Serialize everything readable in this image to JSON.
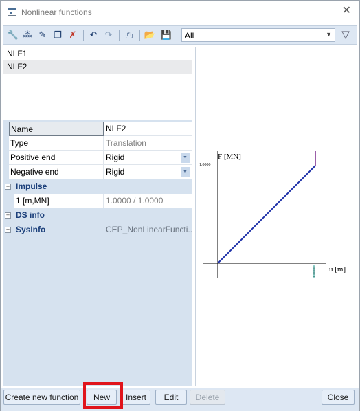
{
  "window": {
    "title": "Nonlinear functions"
  },
  "toolbar": {
    "icons": [
      "function-icon",
      "network-icon",
      "pencil-icon",
      "copy-icon",
      "delete-icon",
      "undo-icon",
      "redo-icon",
      "print-icon",
      "open-folder-icon",
      "save-icon"
    ],
    "filter_value": "All"
  },
  "functions": [
    "NLF1",
    "NLF2"
  ],
  "selected_function": "NLF2",
  "properties": {
    "name": {
      "label": "Name",
      "value": "NLF2"
    },
    "type": {
      "label": "Type",
      "value": "Translation"
    },
    "positive_end": {
      "label": "Positive end",
      "value": "Rigid"
    },
    "negative_end": {
      "label": "Negative end",
      "value": "Rigid"
    },
    "impulse": {
      "label": "Impulse",
      "row_label": "1 [m,MN]",
      "row_value": "1.0000 / 1.0000",
      "expander": "−"
    },
    "ds_info": {
      "label": "DS info",
      "expander": "+"
    },
    "sysinfo": {
      "label": "SysInfo",
      "value": "CEP_NonLinearFuncti...",
      "expander": "+"
    }
  },
  "graph": {
    "y_axis_label": "F [MN]",
    "x_axis_label": "u [m]",
    "y_tick": "1.0000",
    "x_tick": "1.0000",
    "line_color": "#1c2fa8",
    "end_color": "#7b2a8c",
    "tick_color": "#2aa59a"
  },
  "chart_data": {
    "type": "line",
    "title": "",
    "xlabel": "u [m]",
    "ylabel": "F [MN]",
    "series": [
      {
        "x": [
          0,
          1.0
        ],
        "y": [
          0,
          1.0
        ]
      }
    ]
  },
  "buttons": {
    "create_new_function": "Create new function",
    "new": "New",
    "insert": "Insert",
    "edit": "Edit",
    "delete": "Delete",
    "close": "Close"
  }
}
